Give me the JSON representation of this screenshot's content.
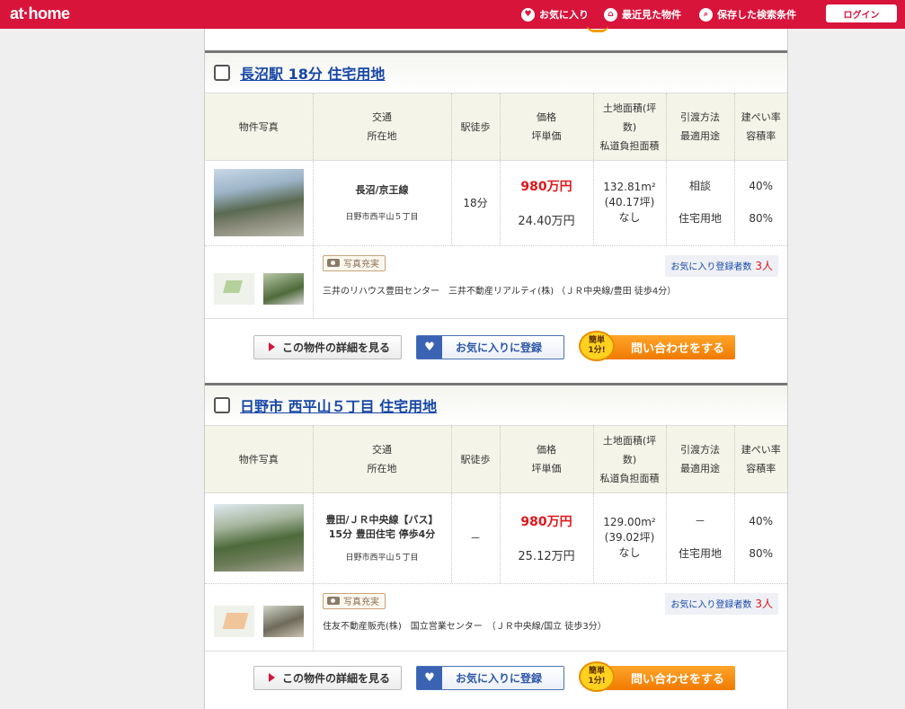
{
  "header": {
    "logo": "at·home",
    "nav_favorites": "お気に入り",
    "nav_recent": "最近見た物件",
    "nav_saved_search": "保存した検索条件",
    "login": "ログイン"
  },
  "table_headers": {
    "photo": "物件写真",
    "access": "交通",
    "address": "所在地",
    "walk": "駅徒歩",
    "price": "価格",
    "unit_price": "坪単価",
    "land_area_1": "土地面積(坪",
    "land_area_2": "数)",
    "road_share": "私道負担面積",
    "delivery": "引渡方法",
    "best_use": "最適用途",
    "coverage": "建ぺい率",
    "floor_ratio": "容積率"
  },
  "listings": [
    {
      "title": "長沼駅 18分 住宅用地",
      "access": "長沼/京王線",
      "access_2": "",
      "address": "日野市西平山５丁目",
      "walk": "18分",
      "price": "980万円",
      "unit_price": "24.40万円",
      "land_area": "132.81m²",
      "land_tsubo": "(40.17坪)",
      "road_share": "なし",
      "delivery": "相談",
      "best_use": "住宅用地",
      "coverage": "40%",
      "floor_ratio": "80%",
      "photo_badge": "写真充実",
      "fav_label": "お気に入り登録者数",
      "fav_count": "3人",
      "company": "三井のリハウス豊田センター　三井不動産リアルティ(株) （ＪＲ中央線/豊田 徒歩4分）",
      "btn_detail": "この物件の詳細を見る",
      "btn_fav": "お気に入りに登録",
      "btn_inquiry": "問い合わせをする",
      "easy_badge_1": "簡単",
      "easy_badge_2": "1分!"
    },
    {
      "title": "日野市 西平山５丁目 住宅用地",
      "access": "豊田/ＪＲ中央線【バス】",
      "access_2": "15分 豊田住宅 停歩4分",
      "address": "日野市西平山５丁目",
      "walk": "－",
      "price": "980万円",
      "unit_price": "25.12万円",
      "land_area": "129.00m²",
      "land_tsubo": "(39.02坪)",
      "road_share": "なし",
      "delivery": "－",
      "best_use": "住宅用地",
      "coverage": "40%",
      "floor_ratio": "80%",
      "photo_badge": "写真充実",
      "fav_label": "お気に入り登録者数",
      "fav_count": "3人",
      "company": "住友不動産販売(株)　国立営業センター　（ＪＲ中央線/国立 徒歩3分）",
      "btn_detail": "この物件の詳細を見る",
      "btn_fav": "お気に入りに登録",
      "btn_inquiry": "問い合わせをする",
      "easy_badge_1": "簡単",
      "easy_badge_2": "1分!"
    }
  ],
  "colors": {
    "brand": "#d8143b",
    "price": "#e0161b",
    "link": "#1747a6",
    "cta": "#f07a00"
  }
}
